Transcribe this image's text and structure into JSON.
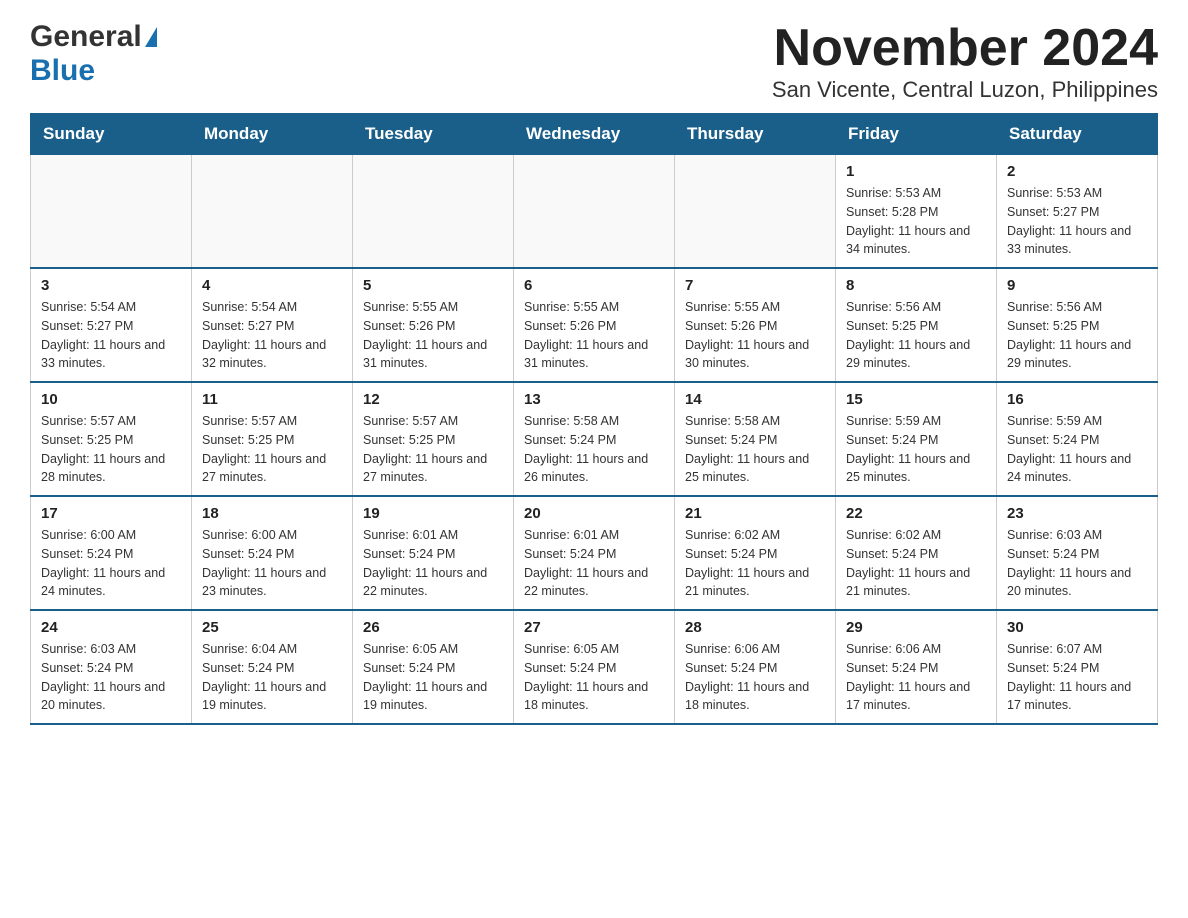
{
  "logo": {
    "general": "General",
    "blue": "Blue"
  },
  "title": "November 2024",
  "subtitle": "San Vicente, Central Luzon, Philippines",
  "weekdays": [
    "Sunday",
    "Monday",
    "Tuesday",
    "Wednesday",
    "Thursday",
    "Friday",
    "Saturday"
  ],
  "weeks": [
    [
      {
        "day": "",
        "sunrise": "",
        "sunset": "",
        "daylight": ""
      },
      {
        "day": "",
        "sunrise": "",
        "sunset": "",
        "daylight": ""
      },
      {
        "day": "",
        "sunrise": "",
        "sunset": "",
        "daylight": ""
      },
      {
        "day": "",
        "sunrise": "",
        "sunset": "",
        "daylight": ""
      },
      {
        "day": "",
        "sunrise": "",
        "sunset": "",
        "daylight": ""
      },
      {
        "day": "1",
        "sunrise": "Sunrise: 5:53 AM",
        "sunset": "Sunset: 5:28 PM",
        "daylight": "Daylight: 11 hours and 34 minutes."
      },
      {
        "day": "2",
        "sunrise": "Sunrise: 5:53 AM",
        "sunset": "Sunset: 5:27 PM",
        "daylight": "Daylight: 11 hours and 33 minutes."
      }
    ],
    [
      {
        "day": "3",
        "sunrise": "Sunrise: 5:54 AM",
        "sunset": "Sunset: 5:27 PM",
        "daylight": "Daylight: 11 hours and 33 minutes."
      },
      {
        "day": "4",
        "sunrise": "Sunrise: 5:54 AM",
        "sunset": "Sunset: 5:27 PM",
        "daylight": "Daylight: 11 hours and 32 minutes."
      },
      {
        "day": "5",
        "sunrise": "Sunrise: 5:55 AM",
        "sunset": "Sunset: 5:26 PM",
        "daylight": "Daylight: 11 hours and 31 minutes."
      },
      {
        "day": "6",
        "sunrise": "Sunrise: 5:55 AM",
        "sunset": "Sunset: 5:26 PM",
        "daylight": "Daylight: 11 hours and 31 minutes."
      },
      {
        "day": "7",
        "sunrise": "Sunrise: 5:55 AM",
        "sunset": "Sunset: 5:26 PM",
        "daylight": "Daylight: 11 hours and 30 minutes."
      },
      {
        "day": "8",
        "sunrise": "Sunrise: 5:56 AM",
        "sunset": "Sunset: 5:25 PM",
        "daylight": "Daylight: 11 hours and 29 minutes."
      },
      {
        "day": "9",
        "sunrise": "Sunrise: 5:56 AM",
        "sunset": "Sunset: 5:25 PM",
        "daylight": "Daylight: 11 hours and 29 minutes."
      }
    ],
    [
      {
        "day": "10",
        "sunrise": "Sunrise: 5:57 AM",
        "sunset": "Sunset: 5:25 PM",
        "daylight": "Daylight: 11 hours and 28 minutes."
      },
      {
        "day": "11",
        "sunrise": "Sunrise: 5:57 AM",
        "sunset": "Sunset: 5:25 PM",
        "daylight": "Daylight: 11 hours and 27 minutes."
      },
      {
        "day": "12",
        "sunrise": "Sunrise: 5:57 AM",
        "sunset": "Sunset: 5:25 PM",
        "daylight": "Daylight: 11 hours and 27 minutes."
      },
      {
        "day": "13",
        "sunrise": "Sunrise: 5:58 AM",
        "sunset": "Sunset: 5:24 PM",
        "daylight": "Daylight: 11 hours and 26 minutes."
      },
      {
        "day": "14",
        "sunrise": "Sunrise: 5:58 AM",
        "sunset": "Sunset: 5:24 PM",
        "daylight": "Daylight: 11 hours and 25 minutes."
      },
      {
        "day": "15",
        "sunrise": "Sunrise: 5:59 AM",
        "sunset": "Sunset: 5:24 PM",
        "daylight": "Daylight: 11 hours and 25 minutes."
      },
      {
        "day": "16",
        "sunrise": "Sunrise: 5:59 AM",
        "sunset": "Sunset: 5:24 PM",
        "daylight": "Daylight: 11 hours and 24 minutes."
      }
    ],
    [
      {
        "day": "17",
        "sunrise": "Sunrise: 6:00 AM",
        "sunset": "Sunset: 5:24 PM",
        "daylight": "Daylight: 11 hours and 24 minutes."
      },
      {
        "day": "18",
        "sunrise": "Sunrise: 6:00 AM",
        "sunset": "Sunset: 5:24 PM",
        "daylight": "Daylight: 11 hours and 23 minutes."
      },
      {
        "day": "19",
        "sunrise": "Sunrise: 6:01 AM",
        "sunset": "Sunset: 5:24 PM",
        "daylight": "Daylight: 11 hours and 22 minutes."
      },
      {
        "day": "20",
        "sunrise": "Sunrise: 6:01 AM",
        "sunset": "Sunset: 5:24 PM",
        "daylight": "Daylight: 11 hours and 22 minutes."
      },
      {
        "day": "21",
        "sunrise": "Sunrise: 6:02 AM",
        "sunset": "Sunset: 5:24 PM",
        "daylight": "Daylight: 11 hours and 21 minutes."
      },
      {
        "day": "22",
        "sunrise": "Sunrise: 6:02 AM",
        "sunset": "Sunset: 5:24 PM",
        "daylight": "Daylight: 11 hours and 21 minutes."
      },
      {
        "day": "23",
        "sunrise": "Sunrise: 6:03 AM",
        "sunset": "Sunset: 5:24 PM",
        "daylight": "Daylight: 11 hours and 20 minutes."
      }
    ],
    [
      {
        "day": "24",
        "sunrise": "Sunrise: 6:03 AM",
        "sunset": "Sunset: 5:24 PM",
        "daylight": "Daylight: 11 hours and 20 minutes."
      },
      {
        "day": "25",
        "sunrise": "Sunrise: 6:04 AM",
        "sunset": "Sunset: 5:24 PM",
        "daylight": "Daylight: 11 hours and 19 minutes."
      },
      {
        "day": "26",
        "sunrise": "Sunrise: 6:05 AM",
        "sunset": "Sunset: 5:24 PM",
        "daylight": "Daylight: 11 hours and 19 minutes."
      },
      {
        "day": "27",
        "sunrise": "Sunrise: 6:05 AM",
        "sunset": "Sunset: 5:24 PM",
        "daylight": "Daylight: 11 hours and 18 minutes."
      },
      {
        "day": "28",
        "sunrise": "Sunrise: 6:06 AM",
        "sunset": "Sunset: 5:24 PM",
        "daylight": "Daylight: 11 hours and 18 minutes."
      },
      {
        "day": "29",
        "sunrise": "Sunrise: 6:06 AM",
        "sunset": "Sunset: 5:24 PM",
        "daylight": "Daylight: 11 hours and 17 minutes."
      },
      {
        "day": "30",
        "sunrise": "Sunrise: 6:07 AM",
        "sunset": "Sunset: 5:24 PM",
        "daylight": "Daylight: 11 hours and 17 minutes."
      }
    ]
  ]
}
